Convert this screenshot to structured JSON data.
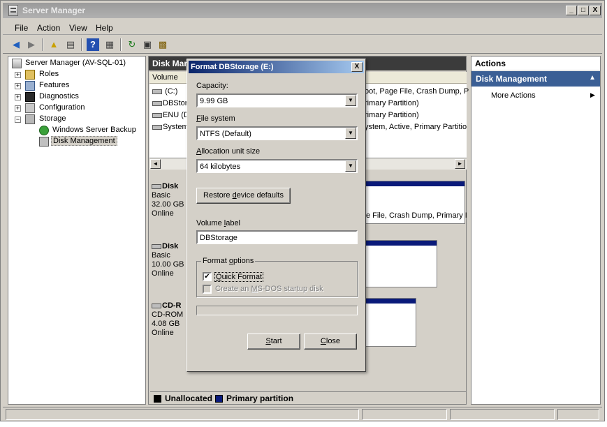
{
  "window": {
    "title": "Server Manager",
    "min_glyph": "_",
    "max_glyph": "□",
    "close_glyph": "X"
  },
  "menu": [
    "File",
    "Action",
    "View",
    "Help"
  ],
  "toolbar_icons": [
    "back-arrow-icon",
    "forward-arrow-icon",
    "up-folder-icon",
    "show-hide-tree-icon",
    "help-icon",
    "properties-icon",
    "refresh-icon",
    "export-icon",
    "settings-icon"
  ],
  "tree": {
    "root": "Server Manager (AV-SQL-01)",
    "items": [
      {
        "label": "Roles",
        "expander": "+"
      },
      {
        "label": "Features",
        "expander": "+"
      },
      {
        "label": "Diagnostics",
        "expander": "+"
      },
      {
        "label": "Configuration",
        "expander": "+"
      },
      {
        "label": "Storage",
        "expander": "−"
      },
      {
        "label": "Windows Server Backup",
        "expander": ""
      },
      {
        "label": "Disk Management",
        "expander": ""
      }
    ]
  },
  "center": {
    "header": "Disk Manag",
    "volume_header": "Volume",
    "volumes": [
      {
        "name": "(C:)",
        "status": "oot, Page File, Crash Dump, P"
      },
      {
        "name": "DBStora",
        "status": "rimary Partition)"
      },
      {
        "name": "ENU (D",
        "status": "rimary Partition)"
      },
      {
        "name": "System",
        "status": "ystem, Active, Primary Partitio"
      }
    ],
    "scroll_left": "◄",
    "scroll_right": "►",
    "disks": [
      {
        "name": "Disk",
        "type": "Basic",
        "size": "32.00 GB",
        "state": "Online",
        "partition_text": "e File, Crash Dump, Primary I"
      },
      {
        "name": "Disk",
        "type": "Basic",
        "size": "10.00 GB",
        "state": "Online",
        "partition_text": ""
      },
      {
        "name": "CD-R",
        "type": "CD-ROM",
        "size": "4.08 GB",
        "state": "Online",
        "partition_text": ""
      }
    ],
    "legend": [
      {
        "label": "Unallocated",
        "color": "#000000"
      },
      {
        "label": "Primary partition",
        "color": "#0a1a7a"
      }
    ]
  },
  "actions": {
    "header": "Actions",
    "section": "Disk Management",
    "collapse_glyph": "▲",
    "items": [
      {
        "label": "More Actions",
        "arrow": "▶"
      }
    ]
  },
  "dialog": {
    "title": "Format DBStorage (E:)",
    "close_glyph": "X",
    "capacity_label": "Capacity:",
    "capacity_value": "9.99 GB",
    "filesystem_label_pre": "",
    "filesystem_label_ul": "F",
    "filesystem_label_post": "ile system",
    "filesystem_value": "NTFS (Default)",
    "alloc_label_ul": "A",
    "alloc_label_post": "llocation unit size",
    "alloc_value": "64 kilobytes",
    "restore_pre": "Restore ",
    "restore_ul": "d",
    "restore_post": "evice defaults",
    "volume_label_pre": "Volume ",
    "volume_label_ul": "l",
    "volume_label_post": "abel",
    "volume_label_value": "DBStorage",
    "format_options_pre": "Format ",
    "format_options_ul": "o",
    "format_options_post": "ptions",
    "quick_format_ul": "Q",
    "quick_format_post": "uick Format",
    "quick_format_checked": "✔",
    "msdos_pre": "Create an ",
    "msdos_ul": "M",
    "msdos_post": "S-DOS startup disk",
    "start_ul": "S",
    "start_post": "tart",
    "close_ul": "C",
    "close_post": "lose",
    "drop_glyph": "▼"
  }
}
